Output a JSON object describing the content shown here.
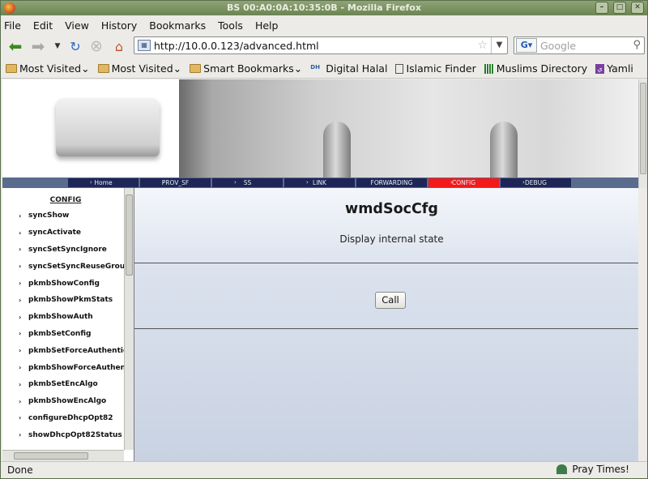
{
  "window": {
    "title": "BS 00:A0:0A:10:35:0B - Mozilla Firefox"
  },
  "menu": [
    "File",
    "Edit",
    "View",
    "History",
    "Bookmarks",
    "Tools",
    "Help"
  ],
  "nav": {
    "url": "http://10.0.0.123/advanced.html",
    "search_placeholder": "Google"
  },
  "bookmarks": [
    "Most Visited",
    "Most Visited",
    "Smart Bookmarks",
    "Digital Halal",
    "Islamic Finder",
    "Muslims Directory",
    "Yamli"
  ],
  "tabs": [
    "Home",
    "PROV_SF",
    "SS",
    "LINK",
    "FORWARDING",
    "CONFIG",
    "DEBUG"
  ],
  "active_tab": "CONFIG",
  "sidebar": {
    "title": "CONFIG",
    "items": [
      "syncShow",
      "syncActivate",
      "syncSetSyncIgnore",
      "syncSetSyncReuseGroup",
      "pkmbShowConfig",
      "pkmbShowPkmStats",
      "pkmbShowAuth",
      "pkmbSetConfig",
      "pkmbSetForceAuthentica",
      "pkmbShowForceAuthenti",
      "pkmbSetEncAlgo",
      "pkmbShowEncAlgo",
      "configureDhcpOpt82",
      "showDhcpOpt82Status"
    ]
  },
  "main": {
    "heading": "wmdSocCfg",
    "description": "Display internal state",
    "call_label": "Call"
  },
  "status": {
    "left": "Done",
    "right": "Pray Times!"
  },
  "colors": {
    "tab_bg": "#1d2656",
    "tab_active": "#f21a1a",
    "tab_strip": "#5a6c8e",
    "titlebar": "#6b8453"
  }
}
